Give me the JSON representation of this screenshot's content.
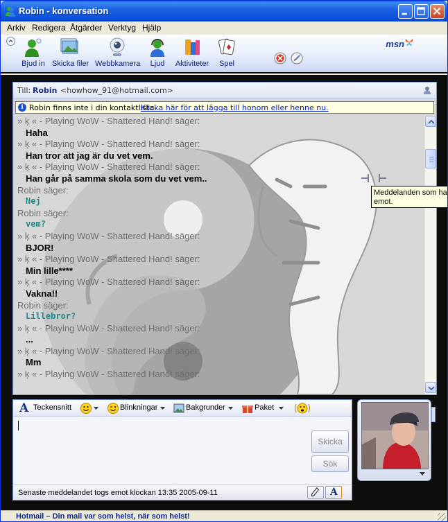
{
  "window": {
    "title": "Robin - konversation"
  },
  "menu": [
    "Arkiv",
    "Redigera",
    "Åtgärder",
    "Verktyg",
    "Hjälp"
  ],
  "toolbar": {
    "items": [
      "Bjud in",
      "Skicka filer",
      "Webbkamera",
      "Ljud",
      "Aktiviteter",
      "Spel"
    ],
    "logo": "msn"
  },
  "to_bar": {
    "label": "Till:",
    "name": "Robin",
    "email": "<howhow_91@hotmail.com>"
  },
  "notice": {
    "text": "Robin finns inte i din kontaktlista.",
    "link": "Klicka här för att lägga till honom eller henne nu."
  },
  "messages": [
    {
      "kind": "sender",
      "text": "» ķ « - Playing WoW - Shattered Hand! säger:"
    },
    {
      "kind": "text",
      "text": "Haha",
      "style": "bold"
    },
    {
      "kind": "sender",
      "text": "» ķ « - Playing WoW - Shattered Hand! säger:"
    },
    {
      "kind": "text",
      "text": "Han tror att jag är du vet vem.",
      "style": "bold"
    },
    {
      "kind": "sender",
      "text": "» ķ « - Playing WoW - Shattered Hand! säger:"
    },
    {
      "kind": "text",
      "text": "Han går på samma skola som du vet vem..",
      "style": "bold"
    },
    {
      "kind": "sender",
      "text": "Robin säger:"
    },
    {
      "kind": "text",
      "text": "Nej",
      "style": "teal"
    },
    {
      "kind": "sender",
      "text": "Robin säger:"
    },
    {
      "kind": "text",
      "text": "vem?",
      "style": "teal"
    },
    {
      "kind": "sender",
      "text": "» ķ « - Playing WoW - Shattered Hand! säger:"
    },
    {
      "kind": "text",
      "text": "BJOR!",
      "style": "bold"
    },
    {
      "kind": "sender",
      "text": "» ķ « - Playing WoW - Shattered Hand! säger:"
    },
    {
      "kind": "text",
      "text": "Min lille****",
      "style": "bold"
    },
    {
      "kind": "sender",
      "text": "» ķ « - Playing WoW - Shattered Hand! säger:"
    },
    {
      "kind": "text",
      "text": "Vakna!!",
      "style": "bold"
    },
    {
      "kind": "sender",
      "text": "Robin säger:"
    },
    {
      "kind": "text",
      "text": "Lillebror?",
      "style": "teal"
    },
    {
      "kind": "sender",
      "text": "» ķ « - Playing WoW - Shattered Hand! säger:"
    },
    {
      "kind": "text",
      "text": "...",
      "style": "bold"
    },
    {
      "kind": "sender",
      "text": "» ķ « - Playing WoW - Shattered Hand! säger:"
    },
    {
      "kind": "text",
      "text": "Mm",
      "style": "bold"
    },
    {
      "kind": "sender",
      "text": "» ķ « - Playing WoW - Shattered Hand! säger:"
    }
  ],
  "tooltip": {
    "line1": "Meddelanden som har s",
    "line2": "emot."
  },
  "format_bar": {
    "font": "Teckensnitt",
    "winks": "Blinkningar",
    "backgrounds": "Bakgrunder",
    "package": "Paket"
  },
  "buttons": {
    "send": "Skicka",
    "search": "Sök"
  },
  "status": {
    "last_message": "Senaste meddelandet togs emot klockan 13:35 2005-09-11"
  },
  "bottom": {
    "text": "Hotmail – Din mail var som helst, när som helst!"
  },
  "colors": {
    "title_blue": "#0b4fd6",
    "link": "#0019cc",
    "teal_text": "#1f8a8a",
    "frame_black": "#0d0d0d"
  }
}
